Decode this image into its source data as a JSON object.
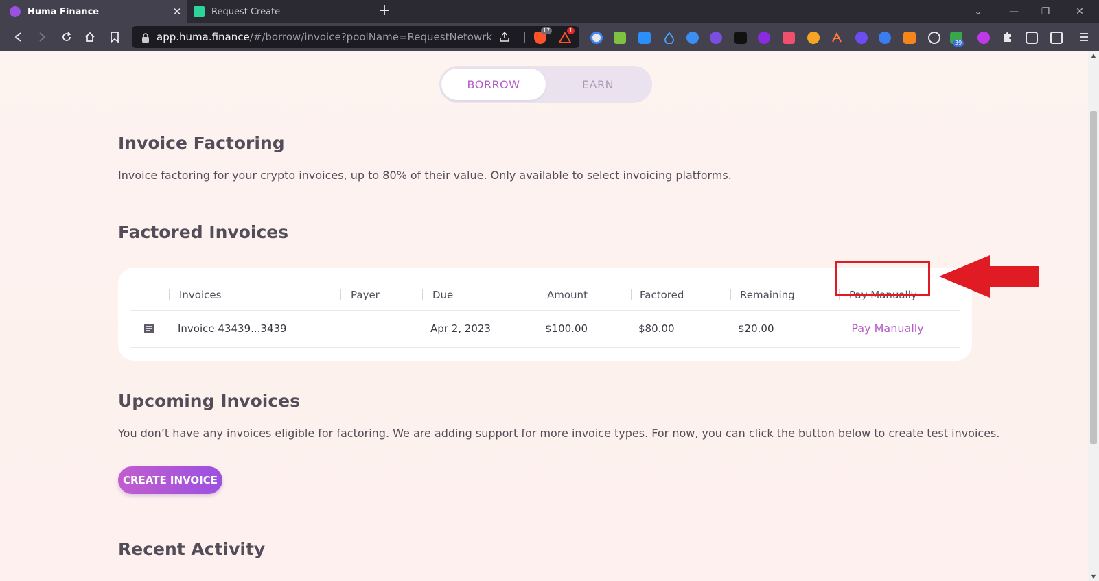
{
  "browser": {
    "tabs": [
      {
        "title": "Huma Finance",
        "active": true,
        "favicon_color": "#9b51e0"
      },
      {
        "title": "Request Create",
        "active": false,
        "favicon_color": "#2bd59a"
      }
    ],
    "url_host": "app.huma.finance",
    "url_path": "/#/borrow/invoice?poolName=RequestNetowrk",
    "badges": {
      "brave_shields": "17",
      "brave_rewards": "1",
      "calendar_ext": "39"
    }
  },
  "mode_toggle": {
    "borrow_label": "BORROW",
    "earn_label": "EARN",
    "selected": "BORROW"
  },
  "invoice_factoring": {
    "title": "Invoice Factoring",
    "description": "Invoice factoring for your crypto invoices, up to 80% of their value. Only available to select invoicing platforms."
  },
  "factored_invoices": {
    "title": "Factored Invoices",
    "columns": [
      "Invoices",
      "Payer",
      "Due",
      "Amount",
      "Factored",
      "Remaining",
      "Pay Manually"
    ],
    "rows": [
      {
        "invoice": "Invoice 43439...3439",
        "payer": "",
        "due": "Apr 2, 2023",
        "amount": "$100.00",
        "factored": "$80.00",
        "remaining": "$20.00",
        "action": "Pay Manually"
      }
    ]
  },
  "upcoming_invoices": {
    "title": "Upcoming Invoices",
    "description": "You don’t have any invoices eligible for factoring. We are adding support for more invoice types. For now, you can click the button below to create test invoices.",
    "button_label": "CREATE INVOICE"
  },
  "recent_activity": {
    "title": "Recent Activity"
  },
  "colors": {
    "accent": "#b35ac8",
    "heading": "#524d59",
    "annotation": "#e01b24"
  }
}
